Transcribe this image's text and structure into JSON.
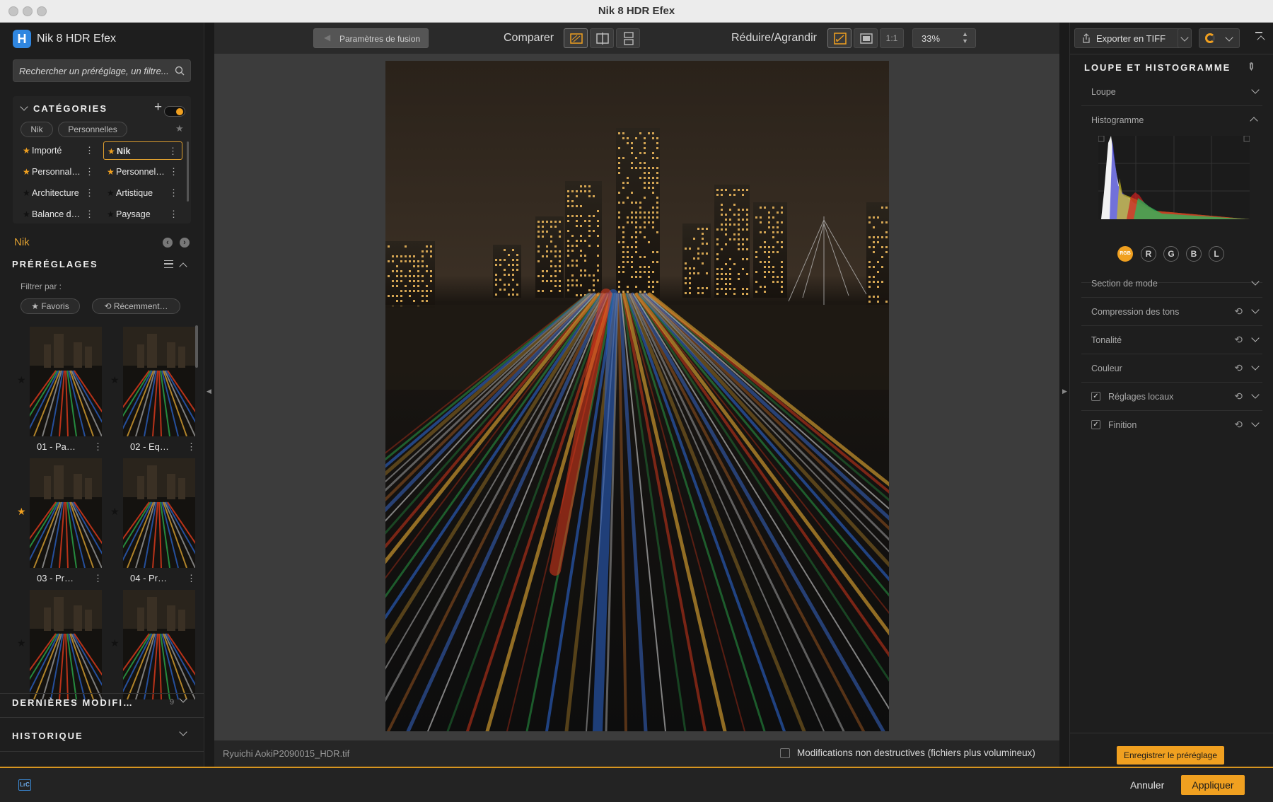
{
  "window": {
    "title": "Nik 8 HDR Efex"
  },
  "app": {
    "name": "Nik 8 HDR Efex",
    "logo_letter": "H"
  },
  "search": {
    "placeholder": "Rechercher un préréglage, un filtre..."
  },
  "categories": {
    "title": "CATÉGORIES",
    "add_label": "+",
    "pills": [
      "Nik",
      "Personnelles"
    ],
    "items": [
      {
        "label": "Importé",
        "starred": true,
        "selected": false
      },
      {
        "label": "Nik",
        "starred": true,
        "selected": true
      },
      {
        "label": "Personnal…",
        "starred": true,
        "selected": false
      },
      {
        "label": "Personnel…",
        "starred": true,
        "selected": false
      },
      {
        "label": "Architecture",
        "starred": false,
        "selected": false
      },
      {
        "label": "Artistique",
        "starred": false,
        "selected": false
      },
      {
        "label": "Balance d…",
        "starred": false,
        "selected": false
      },
      {
        "label": "Paysage",
        "starred": false,
        "selected": false
      }
    ]
  },
  "source_label": "Nik",
  "presets": {
    "title": "PRÉRÉGLAGES",
    "filter_label": "Filtrer par :",
    "filters": [
      "Favoris",
      "Récemment…"
    ],
    "items": [
      {
        "label": "01 - Pa…",
        "favorite": false
      },
      {
        "label": "02 - Eq…",
        "favorite": false
      },
      {
        "label": "03 - Pr…",
        "favorite": true
      },
      {
        "label": "04 - Pr…",
        "favorite": false
      },
      {
        "label": "",
        "favorite": false
      },
      {
        "label": "",
        "favorite": false
      }
    ]
  },
  "recent": {
    "title": "DERNIÈRES MODIFI…",
    "count": "9"
  },
  "history": {
    "title": "HISTORIQUE"
  },
  "toolbar": {
    "fusion_params": "Paramètres de fusion",
    "compare_label": "Comparer",
    "zoom_label": "Réduire/Agrandir",
    "one_to_one": "1:1",
    "zoom_value": "33%",
    "export_label": "Exporter en TIFF"
  },
  "status": {
    "filename": "Ryuichi AokiP2090015_HDR.tif",
    "nondestructive_label": "Modifications non destructives (fichiers plus volumineux)"
  },
  "right_panel": {
    "title": "LOUPE ET HISTOGRAMME",
    "loupe": "Loupe",
    "histogram": "Histogramme",
    "channels": [
      "RGB",
      "R",
      "G",
      "B",
      "L"
    ],
    "sections": [
      {
        "label": "Section de mode",
        "reset": false,
        "checkbox": false
      },
      {
        "label": "Compression des tons",
        "reset": true,
        "checkbox": false
      },
      {
        "label": "Tonalité",
        "reset": true,
        "checkbox": false
      },
      {
        "label": "Couleur",
        "reset": true,
        "checkbox": false
      },
      {
        "label": "Réglages locaux",
        "reset": true,
        "checkbox": true
      },
      {
        "label": "Finition",
        "reset": true,
        "checkbox": true
      }
    ],
    "save_preset": "Enregistrer le préréglage"
  },
  "bottom": {
    "lrc_badge": "LrC",
    "cancel": "Annuler",
    "apply": "Appliquer"
  },
  "colors": {
    "accent": "#f0a020",
    "accent_dark": "#d79520",
    "selected_border": "#e0a030"
  }
}
